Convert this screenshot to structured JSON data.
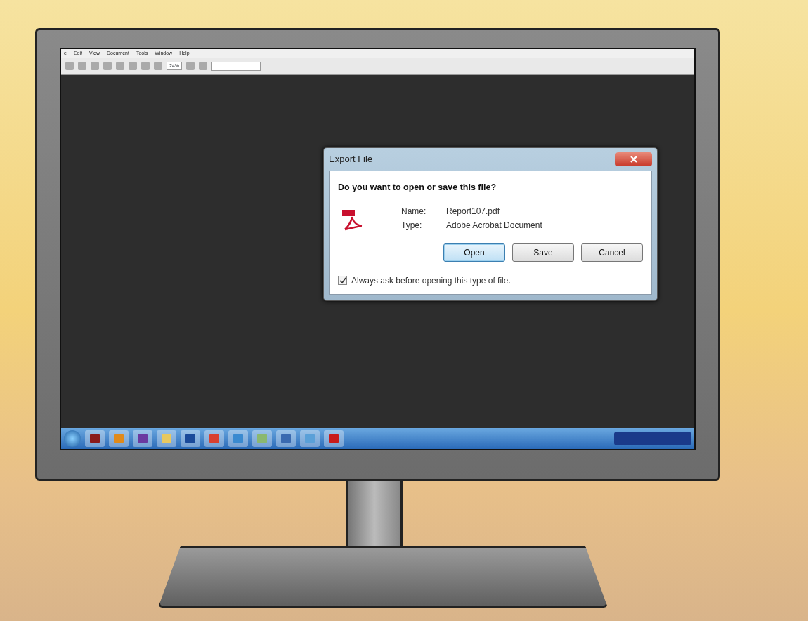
{
  "app": {
    "menu": [
      {
        "label": "e"
      },
      {
        "label": "Edit"
      },
      {
        "label": "View"
      },
      {
        "label": "Document"
      },
      {
        "label": "Tools"
      },
      {
        "label": "Window"
      },
      {
        "label": "Help"
      }
    ],
    "toolbar": {
      "zoom": "24%"
    }
  },
  "dialog": {
    "title": "Export File",
    "question": "Do you want to open or save this file?",
    "fields": [
      {
        "label": "Name:",
        "value": "Report107.pdf"
      },
      {
        "label": "Type:",
        "value": "Adobe Acrobat Document"
      }
    ],
    "buttons": [
      {
        "label": "Open",
        "default": true
      },
      {
        "label": "Save",
        "default": false
      },
      {
        "label": "Cancel",
        "default": false
      }
    ],
    "checkbox": {
      "label": "Always ask before opening this type of file.",
      "checked": true
    }
  },
  "taskbar": {
    "icons": [
      {
        "color": "#8a1a1a"
      },
      {
        "color": "#e08a1a"
      },
      {
        "color": "#6a3aa0"
      },
      {
        "color": "#e8c860"
      },
      {
        "color": "#1a4a9a"
      },
      {
        "color": "#d84030"
      },
      {
        "color": "#3a8ad0"
      },
      {
        "color": "#8ab870"
      },
      {
        "color": "#3a6ab0"
      },
      {
        "color": "#5aa0d8"
      },
      {
        "color": "#c81a1a"
      }
    ]
  }
}
